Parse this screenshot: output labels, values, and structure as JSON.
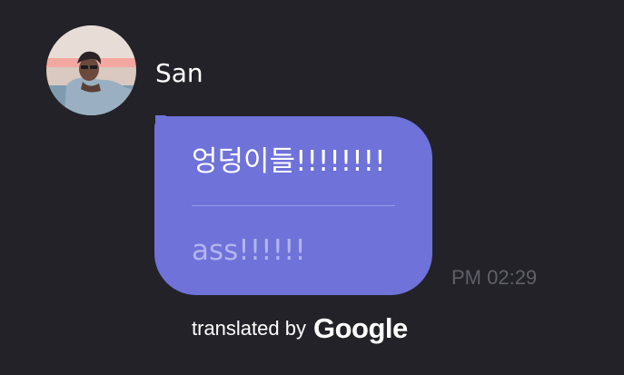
{
  "message": {
    "sender_name": "San",
    "avatar_icon": "user-profile-photo",
    "original_text": "엉덩이들!!!!!!!!",
    "translated_text": "ass!!!!!!",
    "timestamp": "PM 02:29",
    "bubble_color": "#6e72d9"
  },
  "translation": {
    "attribution_prefix": "translated by",
    "provider": "Google"
  },
  "colors": {
    "background": "#222228",
    "original_text": "#ffffff",
    "translated_text": "#b3b5ee",
    "timestamp": "#5f6068"
  }
}
